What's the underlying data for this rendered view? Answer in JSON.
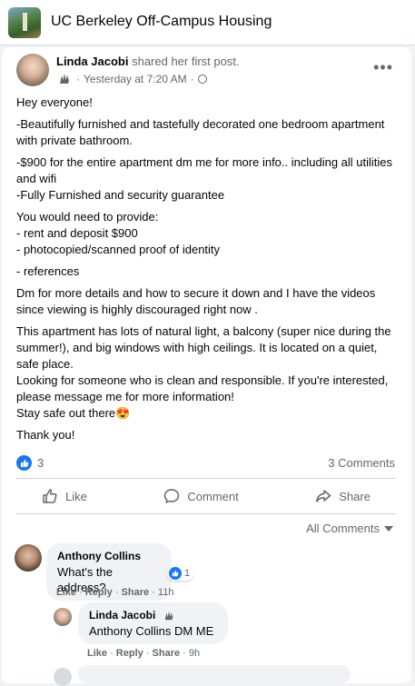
{
  "header": {
    "group_title": "UC Berkeley Off-Campus Housing"
  },
  "post": {
    "author_name": "Linda Jacobi",
    "shared_text": "shared her first post.",
    "timestamp": "Yesterday at 7:20 AM",
    "paragraphs": [
      "Hey everyone!",
      "-Beautifully furnished and tastefully decorated one bedroom apartment with private bathroom.",
      "-$900 for the entire apartment dm me for more info.. including all utilities and wifi\n-Fully Furnished and security guarantee",
      "You would need to provide:\n- rent and deposit $900\n-  photocopied/scanned proof of identity",
      "-  references",
      "Dm for more details and how to secure it down and I have the videos since viewing is highly discouraged right now .",
      "This apartment has lots of natural light, a balcony (super nice during the summer!), and big windows with high ceilings. It is located on a quiet, safe place.\nLooking for someone who is clean and responsible. If you're interested, please message me for more information!\nStay safe out there😍",
      "Thank you!"
    ],
    "reaction_count": "3",
    "comments_count": "3 Comments"
  },
  "actions": {
    "like": "Like",
    "comment": "Comment",
    "share": "Share"
  },
  "comments_filter": "All Comments",
  "comments": [
    {
      "author": "Anthony Collins",
      "text": "What's the address?",
      "reaction_count": "1",
      "like": "Like",
      "reply": "Reply",
      "share": "Share",
      "time": "11h"
    },
    {
      "author": "Linda Jacobi",
      "text": "Anthony Collins DM ME",
      "like": "Like",
      "reply": "Reply",
      "share": "Share",
      "time": "9h"
    }
  ],
  "colors": {
    "accent": "#1877f2",
    "secondary_text": "#65676b",
    "background": "#f0f2f5"
  },
  "icons": [
    "group-thumbnail",
    "new-member-badge-icon",
    "globe-icon",
    "more-icon",
    "like-reaction-icon",
    "thumbs-up-icon",
    "comment-icon",
    "share-icon",
    "chevron-down-icon"
  ]
}
